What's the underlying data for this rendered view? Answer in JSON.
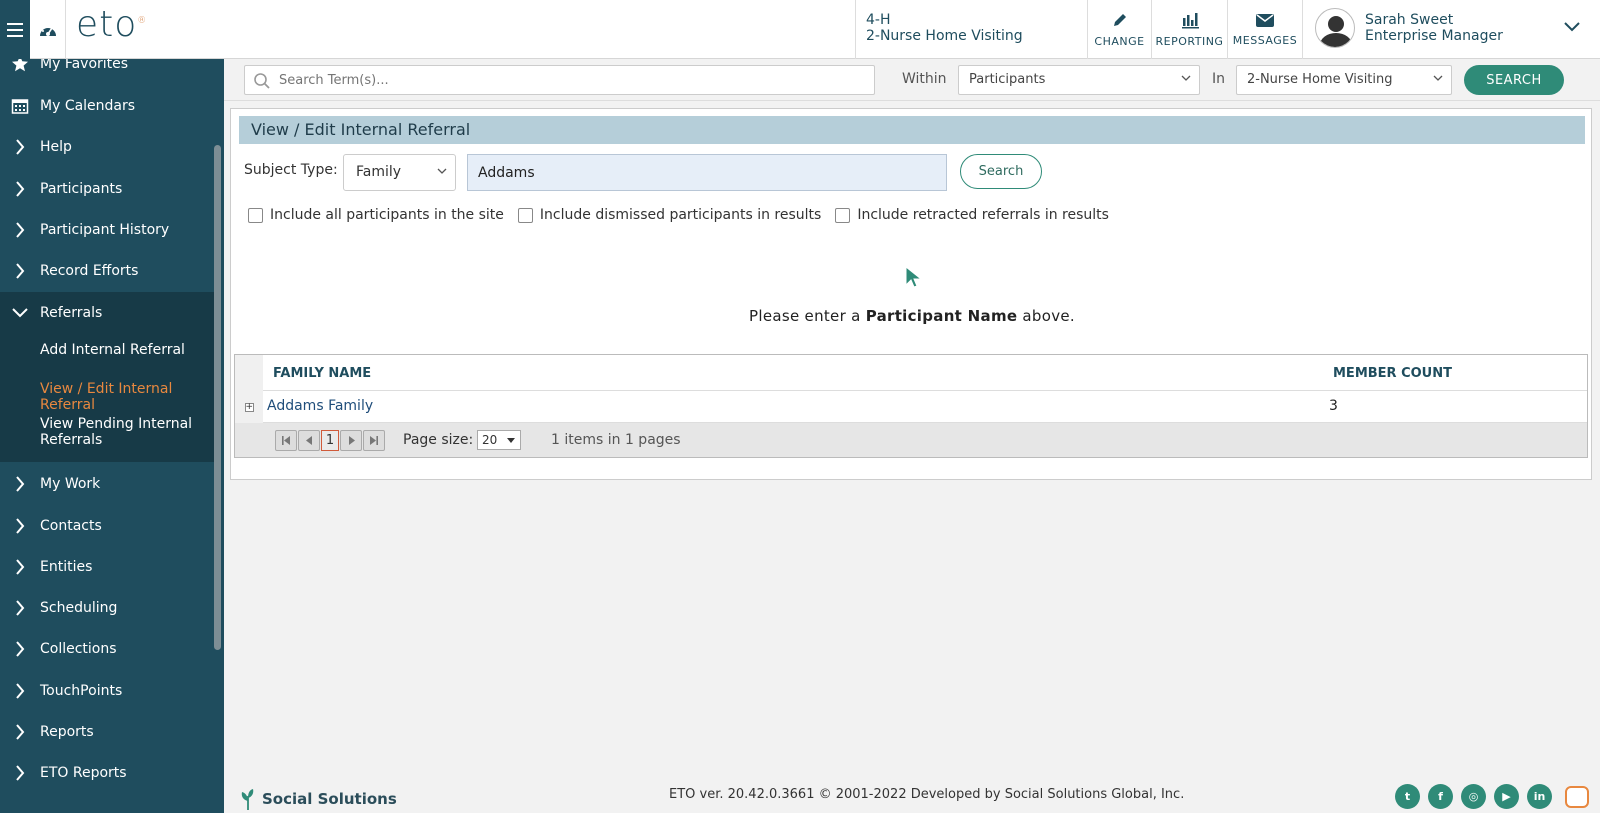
{
  "header": {
    "logo": "eto",
    "site_code": "4-H",
    "program": "2-Nurse Home Visiting",
    "buttons": [
      {
        "label": "CHANGE",
        "icon": "pencil-icon"
      },
      {
        "label": "REPORTING",
        "icon": "bar-chart-icon"
      },
      {
        "label": "MESSAGES",
        "icon": "envelope-icon"
      }
    ],
    "user": {
      "name": "Sarah Sweet",
      "role": "Enterprise Manager"
    }
  },
  "sidebar": {
    "items": [
      {
        "label": "My Favorites",
        "icon": "star-icon"
      },
      {
        "label": "My Calendars",
        "icon": "calendar-icon"
      },
      {
        "label": "Help",
        "icon": "chevron-right-icon"
      },
      {
        "label": "Participants",
        "icon": "chevron-right-icon"
      },
      {
        "label": "Participant History",
        "icon": "chevron-right-icon"
      },
      {
        "label": "Record Efforts",
        "icon": "chevron-right-icon"
      },
      {
        "label": "Referrals",
        "icon": "chevron-down-icon"
      },
      {
        "label": "My Work",
        "icon": "chevron-right-icon"
      },
      {
        "label": "Contacts",
        "icon": "chevron-right-icon"
      },
      {
        "label": "Entities",
        "icon": "chevron-right-icon"
      },
      {
        "label": "Scheduling",
        "icon": "chevron-right-icon"
      },
      {
        "label": "Collections",
        "icon": "chevron-right-icon"
      },
      {
        "label": "TouchPoints",
        "icon": "chevron-right-icon"
      },
      {
        "label": "Reports",
        "icon": "chevron-right-icon"
      },
      {
        "label": "ETO Reports",
        "icon": "chevron-right-icon"
      }
    ],
    "referrals_sub": [
      {
        "label": "Add Internal Referral"
      },
      {
        "label": "View / Edit Internal Referral"
      },
      {
        "label": "View Pending Internal Referrals"
      }
    ]
  },
  "search": {
    "placeholder": "Search Term(s)...",
    "within_label": "Within",
    "within_value": "Participants",
    "in_label": "In",
    "in_value": "2-Nurse Home Visiting",
    "button": "SEARCH"
  },
  "panel": {
    "title": "View / Edit Internal Referral",
    "subject_type_label": "Subject Type:",
    "subject_type_value": "Family",
    "name_value": "Addams",
    "search_button": "Search",
    "checkboxes": [
      {
        "label": "Include all participants in the site",
        "checked": false
      },
      {
        "label": "Include dismissed participants in results",
        "checked": false
      },
      {
        "label": "Include retracted referrals in results",
        "checked": false
      }
    ],
    "prompt_prefix": "Please enter a ",
    "prompt_bold": "Participant Name",
    "prompt_suffix": " above."
  },
  "grid": {
    "columns": [
      "FAMILY NAME",
      "MEMBER COUNT"
    ],
    "rows": [
      {
        "family_name": "Addams Family",
        "member_count": "3",
        "expander": "+"
      }
    ],
    "pager": {
      "current_page": "1",
      "page_size_label": "Page size:",
      "page_size": "20",
      "info": "1 items in 1 pages"
    }
  },
  "footer": {
    "brand": "Social Solutions",
    "text": "ETO ver. 20.42.0.3661 © 2001-2022 Developed by Social Solutions Global, Inc.",
    "socials": [
      {
        "icon": "twitter-icon",
        "glyph": "t"
      },
      {
        "icon": "facebook-icon",
        "glyph": "f"
      },
      {
        "icon": "instagram-icon",
        "glyph": "◎"
      },
      {
        "icon": "youtube-icon",
        "glyph": "▶"
      },
      {
        "icon": "linkedin-icon",
        "glyph": "in"
      }
    ]
  },
  "colors": {
    "sidebar": "#1f4d5e",
    "accent": "#2f8b78",
    "active": "#e8883f",
    "title_bar": "#b5ced9"
  }
}
